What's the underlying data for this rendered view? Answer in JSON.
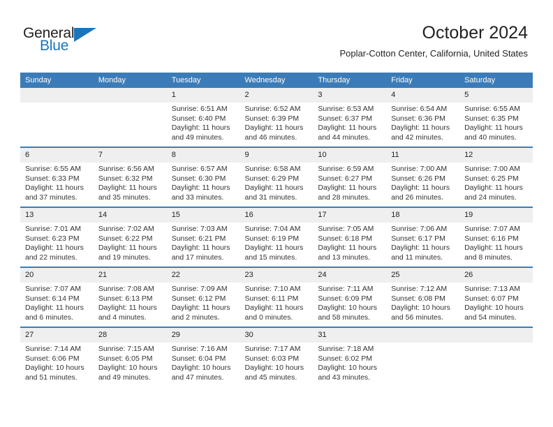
{
  "brand": {
    "name_part1": "General",
    "name_part2": "Blue"
  },
  "header": {
    "title": "October 2024",
    "subtitle": "Poplar-Cotton Center, California, United States"
  },
  "colors": {
    "header_blue": "#3b7cb8",
    "brand_blue": "#1b75bb",
    "daynum_band": "#efefef",
    "text": "#333333"
  },
  "weekdays": [
    "Sunday",
    "Monday",
    "Tuesday",
    "Wednesday",
    "Thursday",
    "Friday",
    "Saturday"
  ],
  "labels": {
    "sunrise": "Sunrise:",
    "sunset": "Sunset:",
    "daylight": "Daylight:"
  },
  "weeks": [
    [
      {
        "day": "",
        "empty": true
      },
      {
        "day": "",
        "empty": true
      },
      {
        "day": "1",
        "sunrise": "Sunrise: 6:51 AM",
        "sunset": "Sunset: 6:40 PM",
        "daylight": "Daylight: 11 hours and 49 minutes."
      },
      {
        "day": "2",
        "sunrise": "Sunrise: 6:52 AM",
        "sunset": "Sunset: 6:39 PM",
        "daylight": "Daylight: 11 hours and 46 minutes."
      },
      {
        "day": "3",
        "sunrise": "Sunrise: 6:53 AM",
        "sunset": "Sunset: 6:37 PM",
        "daylight": "Daylight: 11 hours and 44 minutes."
      },
      {
        "day": "4",
        "sunrise": "Sunrise: 6:54 AM",
        "sunset": "Sunset: 6:36 PM",
        "daylight": "Daylight: 11 hours and 42 minutes."
      },
      {
        "day": "5",
        "sunrise": "Sunrise: 6:55 AM",
        "sunset": "Sunset: 6:35 PM",
        "daylight": "Daylight: 11 hours and 40 minutes."
      }
    ],
    [
      {
        "day": "6",
        "sunrise": "Sunrise: 6:55 AM",
        "sunset": "Sunset: 6:33 PM",
        "daylight": "Daylight: 11 hours and 37 minutes."
      },
      {
        "day": "7",
        "sunrise": "Sunrise: 6:56 AM",
        "sunset": "Sunset: 6:32 PM",
        "daylight": "Daylight: 11 hours and 35 minutes."
      },
      {
        "day": "8",
        "sunrise": "Sunrise: 6:57 AM",
        "sunset": "Sunset: 6:30 PM",
        "daylight": "Daylight: 11 hours and 33 minutes."
      },
      {
        "day": "9",
        "sunrise": "Sunrise: 6:58 AM",
        "sunset": "Sunset: 6:29 PM",
        "daylight": "Daylight: 11 hours and 31 minutes."
      },
      {
        "day": "10",
        "sunrise": "Sunrise: 6:59 AM",
        "sunset": "Sunset: 6:27 PM",
        "daylight": "Daylight: 11 hours and 28 minutes."
      },
      {
        "day": "11",
        "sunrise": "Sunrise: 7:00 AM",
        "sunset": "Sunset: 6:26 PM",
        "daylight": "Daylight: 11 hours and 26 minutes."
      },
      {
        "day": "12",
        "sunrise": "Sunrise: 7:00 AM",
        "sunset": "Sunset: 6:25 PM",
        "daylight": "Daylight: 11 hours and 24 minutes."
      }
    ],
    [
      {
        "day": "13",
        "sunrise": "Sunrise: 7:01 AM",
        "sunset": "Sunset: 6:23 PM",
        "daylight": "Daylight: 11 hours and 22 minutes."
      },
      {
        "day": "14",
        "sunrise": "Sunrise: 7:02 AM",
        "sunset": "Sunset: 6:22 PM",
        "daylight": "Daylight: 11 hours and 19 minutes."
      },
      {
        "day": "15",
        "sunrise": "Sunrise: 7:03 AM",
        "sunset": "Sunset: 6:21 PM",
        "daylight": "Daylight: 11 hours and 17 minutes."
      },
      {
        "day": "16",
        "sunrise": "Sunrise: 7:04 AM",
        "sunset": "Sunset: 6:19 PM",
        "daylight": "Daylight: 11 hours and 15 minutes."
      },
      {
        "day": "17",
        "sunrise": "Sunrise: 7:05 AM",
        "sunset": "Sunset: 6:18 PM",
        "daylight": "Daylight: 11 hours and 13 minutes."
      },
      {
        "day": "18",
        "sunrise": "Sunrise: 7:06 AM",
        "sunset": "Sunset: 6:17 PM",
        "daylight": "Daylight: 11 hours and 11 minutes."
      },
      {
        "day": "19",
        "sunrise": "Sunrise: 7:07 AM",
        "sunset": "Sunset: 6:16 PM",
        "daylight": "Daylight: 11 hours and 8 minutes."
      }
    ],
    [
      {
        "day": "20",
        "sunrise": "Sunrise: 7:07 AM",
        "sunset": "Sunset: 6:14 PM",
        "daylight": "Daylight: 11 hours and 6 minutes."
      },
      {
        "day": "21",
        "sunrise": "Sunrise: 7:08 AM",
        "sunset": "Sunset: 6:13 PM",
        "daylight": "Daylight: 11 hours and 4 minutes."
      },
      {
        "day": "22",
        "sunrise": "Sunrise: 7:09 AM",
        "sunset": "Sunset: 6:12 PM",
        "daylight": "Daylight: 11 hours and 2 minutes."
      },
      {
        "day": "23",
        "sunrise": "Sunrise: 7:10 AM",
        "sunset": "Sunset: 6:11 PM",
        "daylight": "Daylight: 11 hours and 0 minutes."
      },
      {
        "day": "24",
        "sunrise": "Sunrise: 7:11 AM",
        "sunset": "Sunset: 6:09 PM",
        "daylight": "Daylight: 10 hours and 58 minutes."
      },
      {
        "day": "25",
        "sunrise": "Sunrise: 7:12 AM",
        "sunset": "Sunset: 6:08 PM",
        "daylight": "Daylight: 10 hours and 56 minutes."
      },
      {
        "day": "26",
        "sunrise": "Sunrise: 7:13 AM",
        "sunset": "Sunset: 6:07 PM",
        "daylight": "Daylight: 10 hours and 54 minutes."
      }
    ],
    [
      {
        "day": "27",
        "sunrise": "Sunrise: 7:14 AM",
        "sunset": "Sunset: 6:06 PM",
        "daylight": "Daylight: 10 hours and 51 minutes."
      },
      {
        "day": "28",
        "sunrise": "Sunrise: 7:15 AM",
        "sunset": "Sunset: 6:05 PM",
        "daylight": "Daylight: 10 hours and 49 minutes."
      },
      {
        "day": "29",
        "sunrise": "Sunrise: 7:16 AM",
        "sunset": "Sunset: 6:04 PM",
        "daylight": "Daylight: 10 hours and 47 minutes."
      },
      {
        "day": "30",
        "sunrise": "Sunrise: 7:17 AM",
        "sunset": "Sunset: 6:03 PM",
        "daylight": "Daylight: 10 hours and 45 minutes."
      },
      {
        "day": "31",
        "sunrise": "Sunrise: 7:18 AM",
        "sunset": "Sunset: 6:02 PM",
        "daylight": "Daylight: 10 hours and 43 minutes."
      },
      {
        "day": "",
        "empty": true
      },
      {
        "day": "",
        "empty": true
      }
    ]
  ]
}
